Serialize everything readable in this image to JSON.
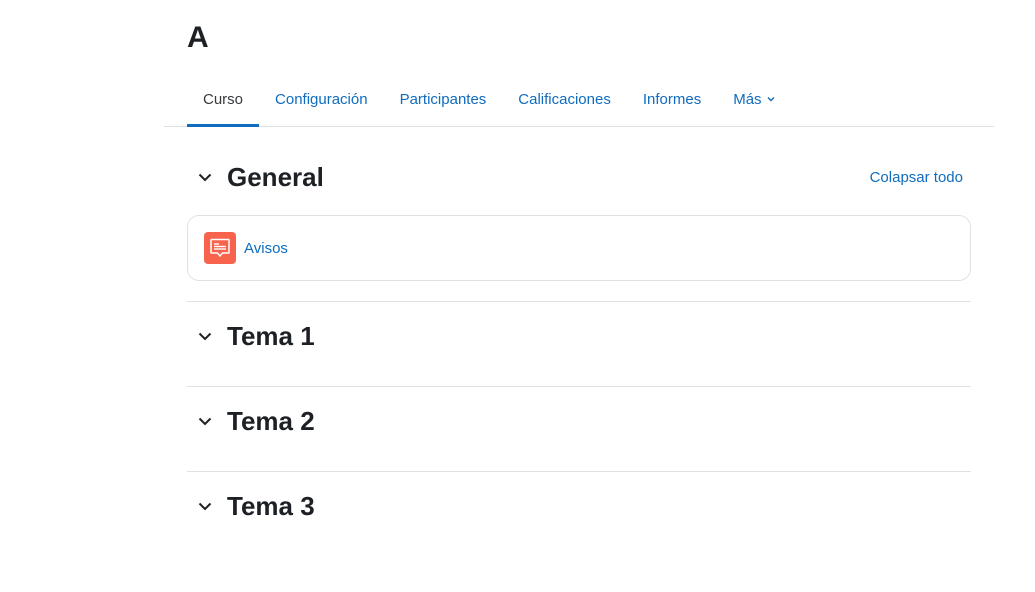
{
  "course": {
    "title": "A"
  },
  "nav": {
    "tabs": [
      {
        "label": "Curso"
      },
      {
        "label": "Configuración"
      },
      {
        "label": "Participantes"
      },
      {
        "label": "Calificaciones"
      },
      {
        "label": "Informes"
      },
      {
        "label": "Más"
      }
    ],
    "active_tab": "Curso"
  },
  "actions": {
    "collapse_all": "Colapsar todo"
  },
  "sections": [
    {
      "title": "General",
      "activities": [
        {
          "name": "Avisos",
          "icon": "forum-icon"
        }
      ]
    },
    {
      "title": "Tema 1"
    },
    {
      "title": "Tema 2"
    },
    {
      "title": "Tema 3"
    }
  ],
  "colors": {
    "link": "#0f6cbf",
    "forum_icon_bg": "#f7634d",
    "border": "#dee2e6"
  }
}
